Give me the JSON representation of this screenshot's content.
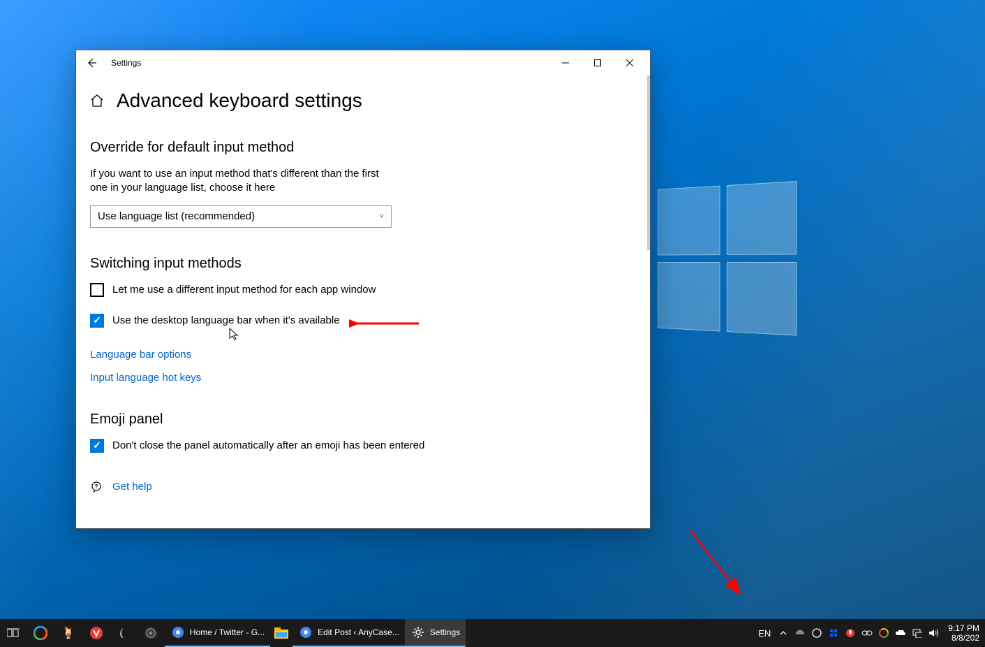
{
  "window": {
    "title": "Settings",
    "page_title": "Advanced keyboard settings"
  },
  "override_section": {
    "heading": "Override for default input method",
    "description": "If you want to use an input method that's different than the first one in your language list, choose it here",
    "dropdown_value": "Use language list (recommended)"
  },
  "switching_section": {
    "heading": "Switching input methods",
    "checkbox1": {
      "label": "Let me use a different input method for each app window",
      "checked": false
    },
    "checkbox2": {
      "label": "Use the desktop language bar when it's available",
      "checked": true
    },
    "link1": "Language bar options",
    "link2": "Input language hot keys"
  },
  "emoji_section": {
    "heading": "Emoji panel",
    "checkbox": {
      "label": "Don't close the panel automatically after an emoji has been entered",
      "checked": true
    }
  },
  "help_link": "Get help",
  "taskbar": {
    "apps": [
      {
        "label": "Home / Twitter - G..."
      },
      {
        "label": "Edit Post ‹ AnyCase..."
      },
      {
        "label": "Settings"
      }
    ],
    "lang": "EN",
    "time": "9:17 PM",
    "date": "8/8/202"
  }
}
